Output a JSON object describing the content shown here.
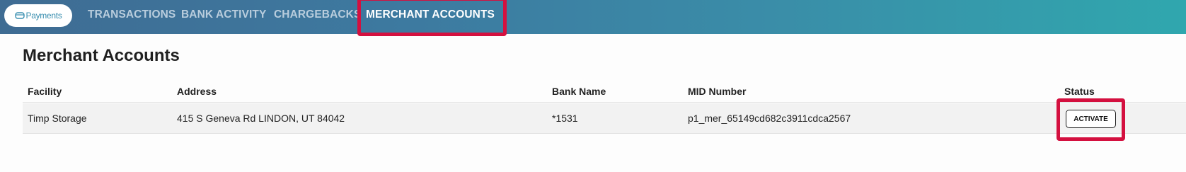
{
  "brand": {
    "logo_text": "Payments",
    "accent": "#3a8fb0"
  },
  "nav": {
    "items": [
      {
        "label": "TRANSACTIONS",
        "active": false
      },
      {
        "label": "BANK ACTIVITY",
        "active": false
      },
      {
        "label": "CHARGEBACKS",
        "active": false
      },
      {
        "label": "MERCHANT ACCOUNTS",
        "active": true
      }
    ],
    "highlight_color": "#d4103f"
  },
  "page": {
    "title": "Merchant Accounts"
  },
  "table": {
    "columns": [
      "Facility",
      "Address",
      "Bank Name",
      "MID Number",
      "Status"
    ],
    "rows": [
      {
        "facility": "Timp Storage",
        "address": "415 S Geneva Rd LINDON, UT 84042",
        "bank_name": "*1531",
        "mid_number": "p1_mer_65149cd682c3911cdca2567",
        "status_action": "ACTIVATE"
      }
    ]
  }
}
